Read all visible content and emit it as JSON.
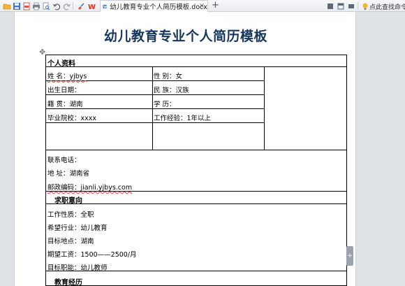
{
  "toolbar": {
    "tab_label": "幼儿教育专业个人简历模板.docx",
    "hint": "点此查找命令",
    "colors": {
      "accent": "#2f6fd0",
      "title_color": "#17365d"
    }
  },
  "document": {
    "title": "幼儿教育专业个人简历模板",
    "sections": {
      "personal": "个人资料",
      "job_intent": "求职意向",
      "education": "教育经历"
    },
    "personal": {
      "name": "姓  名：yjbys",
      "gender": "性  别：女",
      "birth": "出生日期：",
      "ethnicity": "民  族：汉族",
      "native_place": "籍  贯：湖南",
      "degree": "学  历：",
      "school": "毕业院校：xxxx",
      "experience": "工作经验：1年以上"
    },
    "contact": {
      "phone": "联系电话：",
      "address": "地  址：湖南省",
      "postcode": "邮政编码：jianli.yjbys.com"
    },
    "intent": {
      "job_type": "工作性质：全职",
      "industry": "希望行业：幼儿教育",
      "location": "目标地点：湖南",
      "salary": "期望工资：1500——2500/月",
      "position": "目标职能：幼儿教师"
    }
  }
}
